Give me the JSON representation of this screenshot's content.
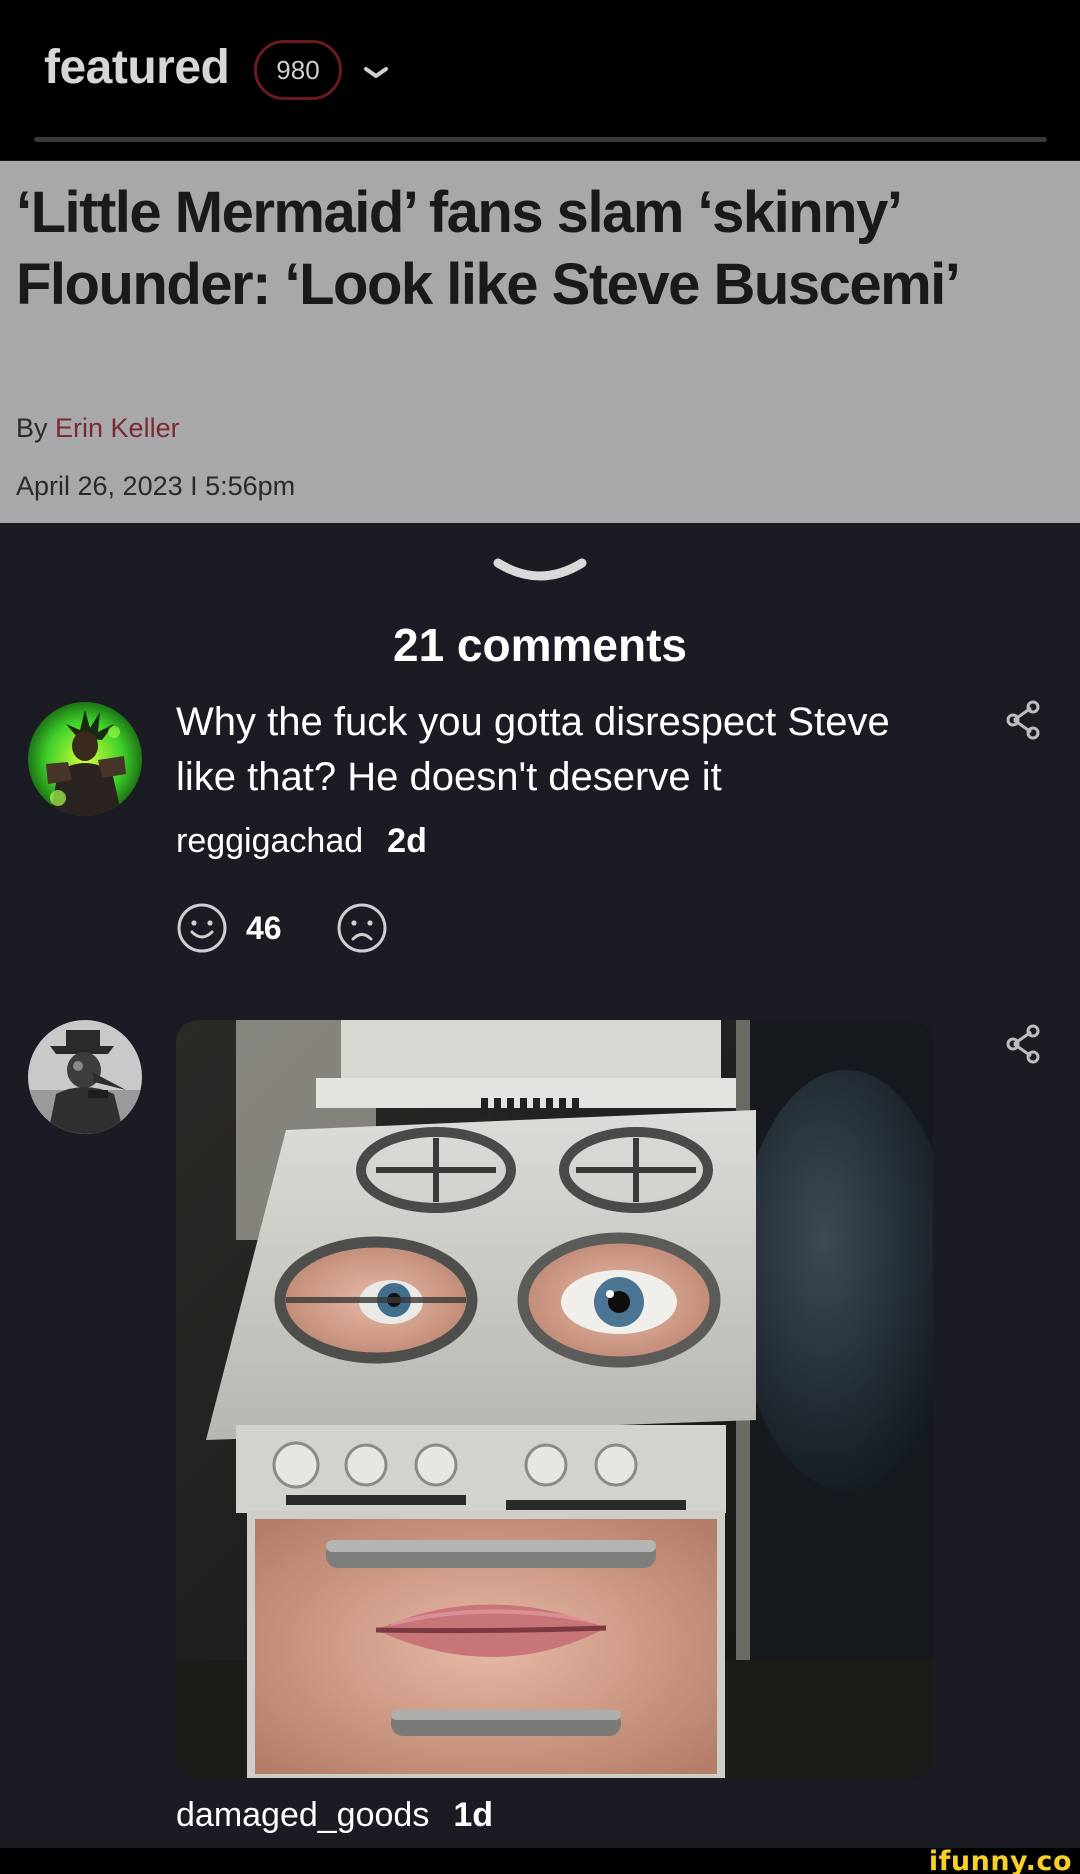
{
  "header": {
    "feed_name": "featured",
    "count": "980",
    "dropdown_icon": "chevron-down-icon"
  },
  "article": {
    "headline": "‘Little Mermaid’ fans slam ‘skinny’ Flounder: ‘Look like Steve Buscemi’",
    "byline_prefix": "By",
    "author": "Erin Keller",
    "date": "April 26, 2023 I 5:56pm",
    "author_color": "#7a2b30"
  },
  "comments_section": {
    "heading": "21 comments",
    "collapse_icon": "chevron-down-icon"
  },
  "comments": [
    {
      "text": "Why the fuck you gotta disrespect Steve like that? He doesn't deserve it",
      "username": "reggigachad",
      "age": "2d",
      "likes": "46",
      "avatar_icon": "green-character-avatar",
      "like_icon": "smile-icon",
      "dislike_icon": "frown-icon",
      "share_icon": "share-icon"
    },
    {
      "username": "damaged_goods",
      "age": "1d",
      "avatar_icon": "plague-doctor-avatar",
      "image_icon": "stove-face-meme-image",
      "share_icon": "share-icon"
    }
  ],
  "footer": {
    "watermark": "ifunny.co"
  },
  "colors": {
    "background": "#1b1c23",
    "topbar": "#000000",
    "badge_border": "#6b1a1e",
    "article_bg": "#a8a8aa",
    "watermark": "#f6d024"
  }
}
